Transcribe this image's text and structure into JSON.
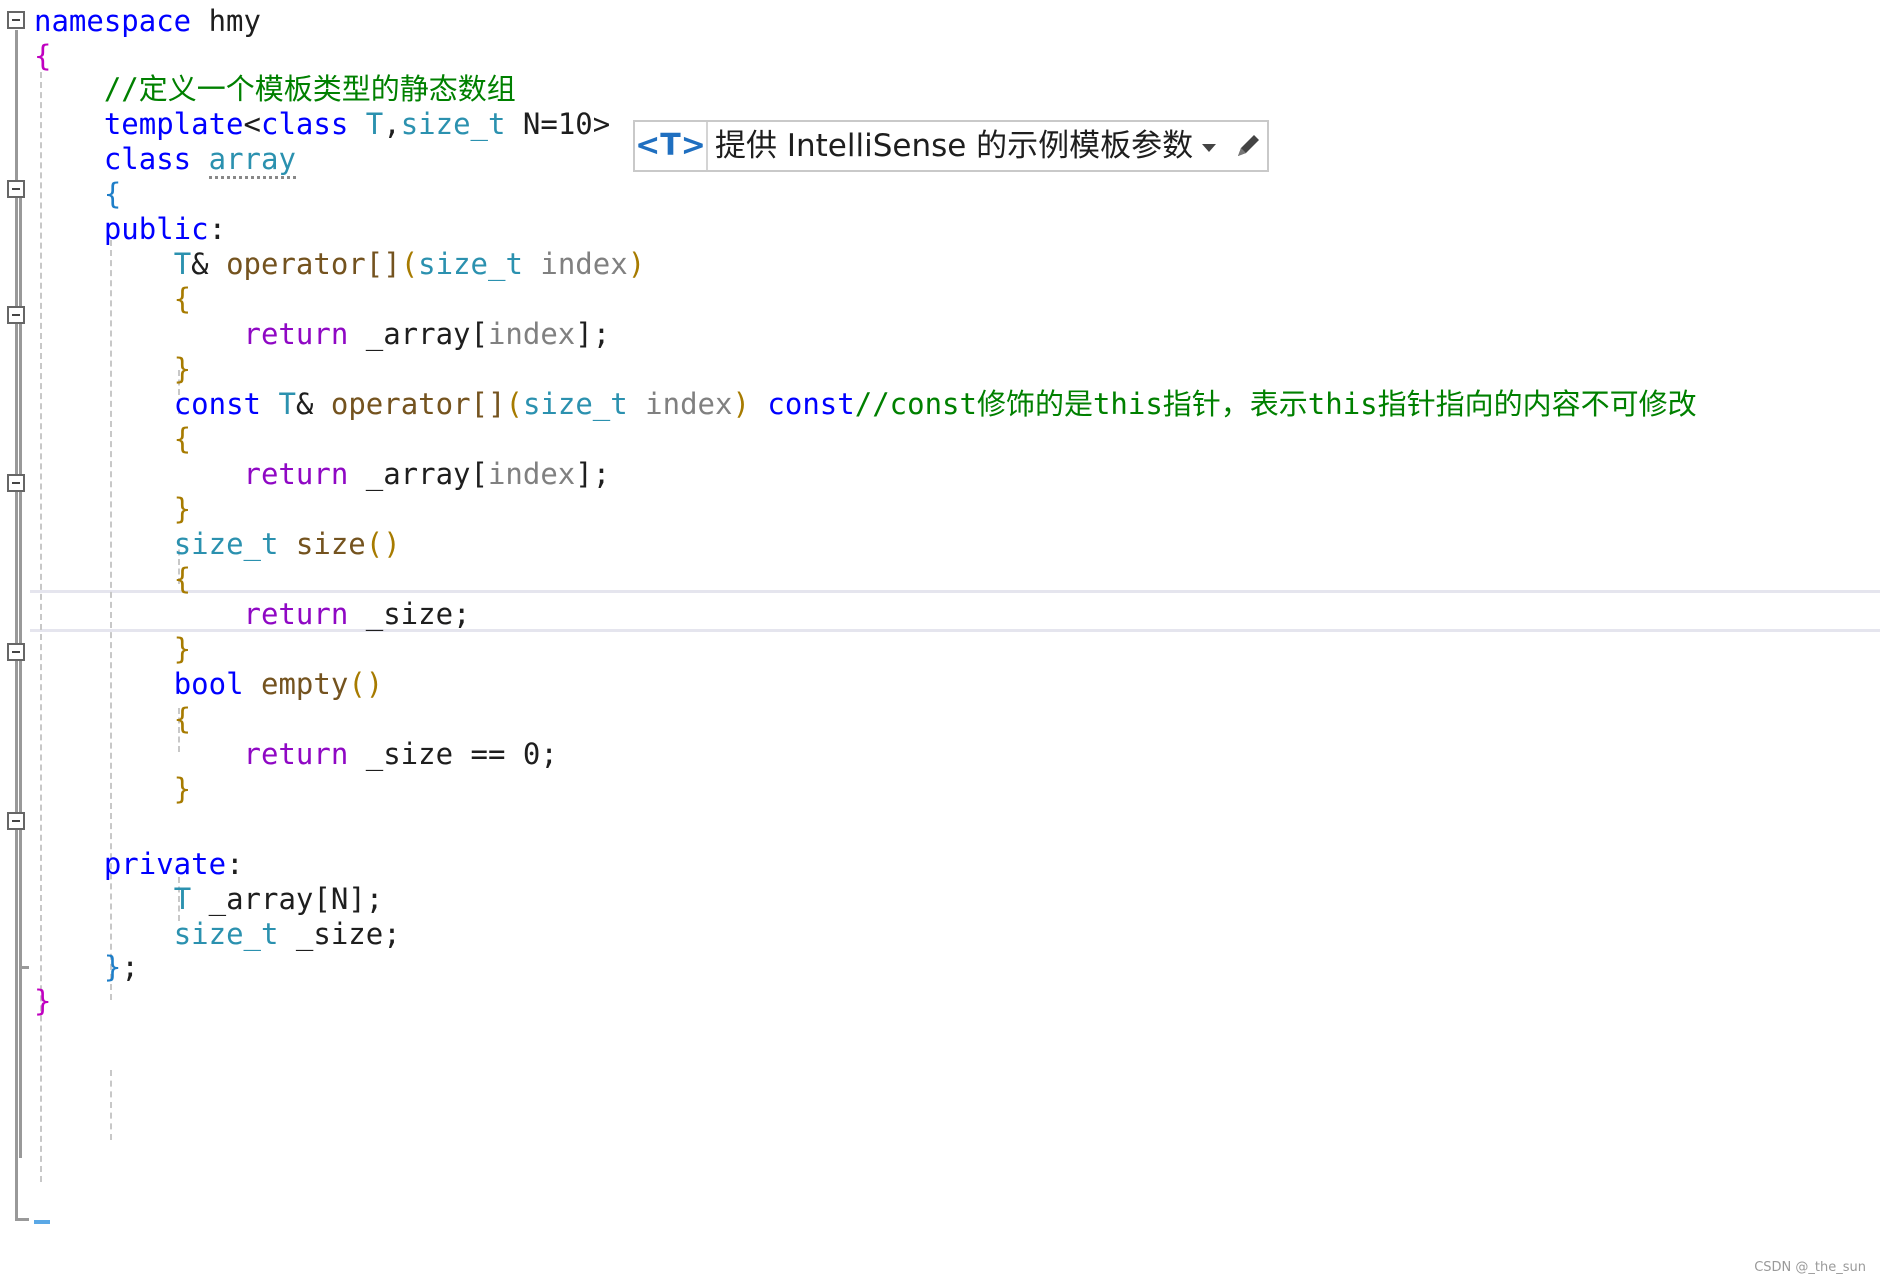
{
  "editor": {
    "lines": [
      {
        "tokens": [
          {
            "t": "namespace",
            "c": "kw"
          },
          {
            "t": " hmy",
            "c": ""
          }
        ]
      },
      {
        "tokens": [
          {
            "t": "{",
            "c": "br1"
          }
        ]
      },
      {
        "tokens": [
          {
            "t": "    //定义一个模板类型的静态数组",
            "c": "cm"
          }
        ]
      },
      {
        "tokens": [
          {
            "t": "    template",
            "c": "kw"
          },
          {
            "t": "<",
            "c": ""
          },
          {
            "t": "class",
            "c": "kw"
          },
          {
            "t": " ",
            "c": ""
          },
          {
            "t": "T",
            "c": "ty"
          },
          {
            "t": ",",
            "c": ""
          },
          {
            "t": "size_t",
            "c": "ty"
          },
          {
            "t": " N=10>",
            "c": ""
          }
        ]
      },
      {
        "tokens": [
          {
            "t": "    class",
            "c": "kw"
          },
          {
            "t": " ",
            "c": ""
          },
          {
            "t": "array",
            "c": "ty squig"
          }
        ]
      },
      {
        "tokens": [
          {
            "t": "    {",
            "c": "br2"
          }
        ]
      },
      {
        "tokens": [
          {
            "t": "    public",
            "c": "kw"
          },
          {
            "t": ":",
            "c": ""
          }
        ]
      },
      {
        "tokens": [
          {
            "t": "        ",
            "c": ""
          },
          {
            "t": "T",
            "c": "ty"
          },
          {
            "t": "& ",
            "c": ""
          },
          {
            "t": "operator[]",
            "c": "fn"
          },
          {
            "t": "(",
            "c": "br3"
          },
          {
            "t": "size_t",
            "c": "ty"
          },
          {
            "t": " ",
            "c": ""
          },
          {
            "t": "index",
            "c": "prm"
          },
          {
            "t": ")",
            "c": "br3"
          }
        ]
      },
      {
        "tokens": [
          {
            "t": "        {",
            "c": "br3"
          }
        ]
      },
      {
        "tokens": [
          {
            "t": "            ",
            "c": ""
          },
          {
            "t": "return",
            "c": "ctl"
          },
          {
            "t": " _array",
            "c": ""
          },
          {
            "t": "[",
            "c": ""
          },
          {
            "t": "index",
            "c": "prm"
          },
          {
            "t": "];",
            "c": ""
          }
        ]
      },
      {
        "tokens": [
          {
            "t": "        }",
            "c": "br3"
          }
        ]
      },
      {
        "tokens": [
          {
            "t": "        ",
            "c": ""
          },
          {
            "t": "const",
            "c": "kw"
          },
          {
            "t": " ",
            "c": ""
          },
          {
            "t": "T",
            "c": "ty"
          },
          {
            "t": "& ",
            "c": ""
          },
          {
            "t": "operator[]",
            "c": "fn"
          },
          {
            "t": "(",
            "c": "br3"
          },
          {
            "t": "size_t",
            "c": "ty"
          },
          {
            "t": " ",
            "c": ""
          },
          {
            "t": "index",
            "c": "prm"
          },
          {
            "t": ")",
            "c": "br3"
          },
          {
            "t": " ",
            "c": ""
          },
          {
            "t": "const",
            "c": "kw"
          },
          {
            "t": "//const修饰的是this指针，表示this指针指向的内容不可修改",
            "c": "cm"
          }
        ]
      },
      {
        "tokens": [
          {
            "t": "        {",
            "c": "br3"
          }
        ]
      },
      {
        "tokens": [
          {
            "t": "            ",
            "c": ""
          },
          {
            "t": "return",
            "c": "ctl"
          },
          {
            "t": " _array",
            "c": ""
          },
          {
            "t": "[",
            "c": ""
          },
          {
            "t": "index",
            "c": "prm"
          },
          {
            "t": "];",
            "c": ""
          }
        ]
      },
      {
        "tokens": [
          {
            "t": "        }",
            "c": "br3"
          }
        ]
      },
      {
        "tokens": [
          {
            "t": "        ",
            "c": ""
          },
          {
            "t": "size_t",
            "c": "ty"
          },
          {
            "t": " ",
            "c": ""
          },
          {
            "t": "size",
            "c": "fn"
          },
          {
            "t": "()",
            "c": "br3"
          }
        ]
      },
      {
        "tokens": [
          {
            "t": "        {",
            "c": "br3"
          }
        ]
      },
      {
        "tokens": [
          {
            "t": "            ",
            "c": ""
          },
          {
            "t": "return",
            "c": "ctl"
          },
          {
            "t": " _size;",
            "c": ""
          }
        ]
      },
      {
        "tokens": [
          {
            "t": "        }",
            "c": "br3"
          }
        ]
      },
      {
        "tokens": [
          {
            "t": "        ",
            "c": ""
          },
          {
            "t": "bool",
            "c": "kw"
          },
          {
            "t": " ",
            "c": ""
          },
          {
            "t": "empty",
            "c": "fn"
          },
          {
            "t": "()",
            "c": "br3"
          }
        ]
      },
      {
        "tokens": [
          {
            "t": "        {",
            "c": "br3"
          }
        ]
      },
      {
        "tokens": [
          {
            "t": "            ",
            "c": ""
          },
          {
            "t": "return",
            "c": "ctl"
          },
          {
            "t": " _size == 0;",
            "c": ""
          }
        ]
      },
      {
        "tokens": [
          {
            "t": "        }",
            "c": "br3"
          }
        ]
      },
      {
        "tokens": [
          {
            "t": "",
            "c": ""
          }
        ]
      },
      {
        "tokens": [
          {
            "t": "    private",
            "c": "kw"
          },
          {
            "t": ":",
            "c": ""
          }
        ]
      },
      {
        "tokens": [
          {
            "t": "        ",
            "c": ""
          },
          {
            "t": "T",
            "c": "ty"
          },
          {
            "t": " _array",
            "c": ""
          },
          {
            "t": "[N];",
            "c": ""
          }
        ]
      },
      {
        "tokens": [
          {
            "t": "        ",
            "c": ""
          },
          {
            "t": "size_t",
            "c": "ty"
          },
          {
            "t": " _size;",
            "c": ""
          }
        ]
      },
      {
        "tokens": [
          {
            "t": "    }",
            "c": "br2"
          },
          {
            "t": ";",
            "c": ""
          }
        ]
      },
      {
        "tokens": [
          {
            "t": "}",
            "c": "br1"
          }
        ]
      }
    ]
  },
  "template_bar": {
    "tag": "<T>",
    "text": "提供 IntelliSense 的示例模板参数",
    "dropdown_icon": "chevron-down-icon",
    "edit_icon": "pencil-icon"
  },
  "watermark": "CSDN @_the_sun"
}
